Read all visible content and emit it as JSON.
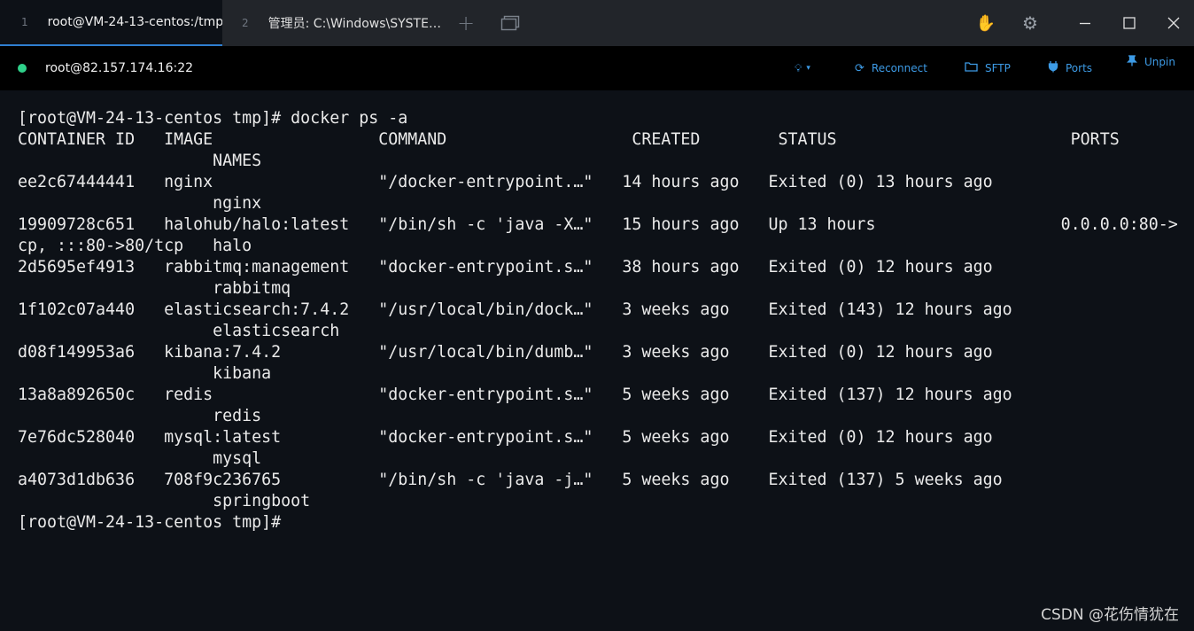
{
  "tabs": [
    {
      "number": "1",
      "title": "root@VM-24-13-centos:/tmp"
    },
    {
      "number": "2",
      "title": "管理员: C:\\Windows\\SYSTE…"
    }
  ],
  "window_controls": {
    "minimize": "—",
    "maximize": "☐",
    "close": "✕"
  },
  "session": {
    "host": "root@82.157.174.16:22",
    "status_color": "#2fd18a",
    "accent_color": "#3d9be6",
    "actions": {
      "reconnect": "Reconnect",
      "sftp": "SFTP",
      "ports": "Ports",
      "unpin": "Unpin"
    }
  },
  "terminal": {
    "lines": [
      "[root@VM-24-13-centos tmp]# docker ps -a",
      "CONTAINER ID   IMAGE                 COMMAND                   CREATED        STATUS                        PORTS",
      "                    NAMES",
      "ee2c67444441   nginx                 \"/docker-entrypoint.…\"   14 hours ago   Exited (0) 13 hours ago",
      "                    nginx",
      "19909728c651   halohub/halo:latest   \"/bin/sh -c 'java -X…\"   15 hours ago   Up 13 hours                   0.0.0.0:80->",
      "cp, :::80->80/tcp   halo",
      "2d5695ef4913   rabbitmq:management   \"docker-entrypoint.s…\"   38 hours ago   Exited (0) 12 hours ago",
      "                    rabbitmq",
      "1f102c07a440   elasticsearch:7.4.2   \"/usr/local/bin/dock…\"   3 weeks ago    Exited (143) 12 hours ago",
      "                    elasticsearch",
      "d08f149953a6   kibana:7.4.2          \"/usr/local/bin/dumb…\"   3 weeks ago    Exited (0) 12 hours ago",
      "                    kibana",
      "13a8a892650c   redis                 \"docker-entrypoint.s…\"   5 weeks ago    Exited (137) 12 hours ago",
      "                    redis",
      "7e76dc528040   mysql:latest          \"docker-entrypoint.s…\"   5 weeks ago    Exited (0) 12 hours ago",
      "                    mysql",
      "a4073d1db636   708f9c236765          \"/bin/sh -c 'java -j…\"   5 weeks ago    Exited (137) 5 weeks ago",
      "                    springboot",
      "[root@VM-24-13-centos tmp]#"
    ]
  },
  "watermark": "CSDN @花伤情犹在"
}
